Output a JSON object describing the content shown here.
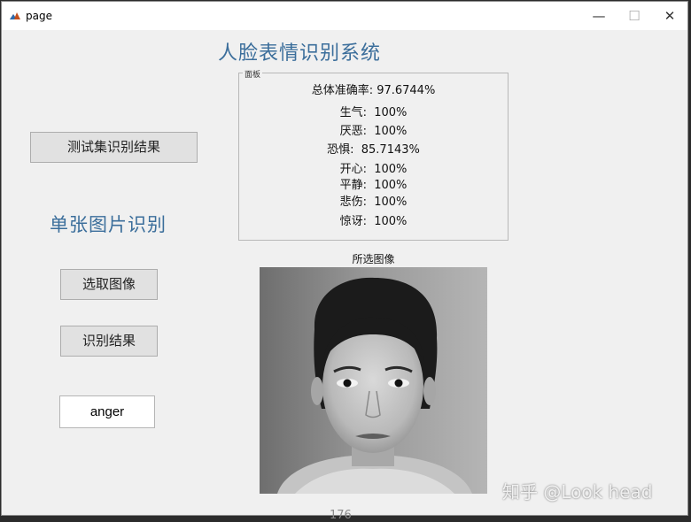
{
  "window": {
    "title": "page",
    "minimize_glyph": "—",
    "maximize_glyph": "☐",
    "close_glyph": "✕"
  },
  "main": {
    "title": "人脸表情识别系统",
    "test_set_button": "测试集识别结果",
    "single_title": "单张图片识别",
    "select_image_button": "选取图像",
    "recognize_button": "识别结果",
    "result_value": "anger"
  },
  "panel": {
    "label": "面板",
    "overall": "总体准确率: 97.6744%",
    "stats": [
      "生气:  100%",
      "厌恶:  100%",
      "恐惧:  85.7143%",
      "开心:  100%",
      "平静:  100%",
      "悲伤:  100%",
      "惊讶:  100%"
    ]
  },
  "image": {
    "caption": "所选图像"
  },
  "overlay": {
    "watermark": "知乎 @Look head",
    "page_number": "176"
  },
  "icons": {
    "app": "matlab-icon"
  }
}
